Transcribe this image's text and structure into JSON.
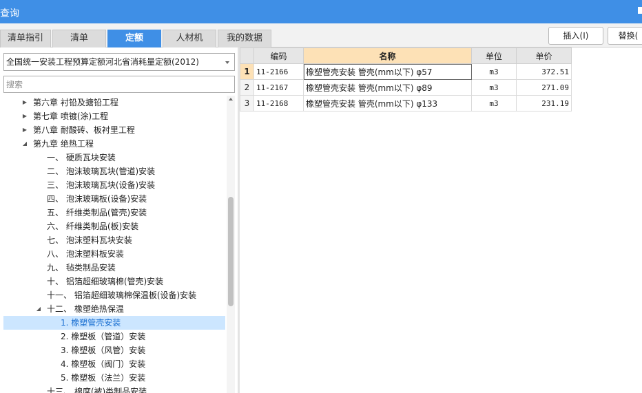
{
  "window": {
    "title": "查询"
  },
  "tabs": [
    {
      "label": "清单指引",
      "active": false
    },
    {
      "label": "清单",
      "active": false
    },
    {
      "label": "定额",
      "active": true
    },
    {
      "label": "人材机",
      "active": false
    },
    {
      "label": "我的数据",
      "active": false
    }
  ],
  "toolbar": {
    "insert_label": "插入(I)",
    "replace_label": "替换("
  },
  "quota_library": {
    "selected": "全国统一安装工程预算定额河北省消耗量定额(2012)"
  },
  "search": {
    "placeholder": "搜索",
    "value": ""
  },
  "tree": [
    {
      "label": "第六章 衬铅及搪铅工程",
      "level": 0,
      "expander": "collapsed"
    },
    {
      "label": "第七章 喷镀(涂)工程",
      "level": 0,
      "expander": "collapsed"
    },
    {
      "label": "第八章 耐酸砖、板衬里工程",
      "level": 0,
      "expander": "collapsed"
    },
    {
      "label": "第九章 绝热工程",
      "level": 0,
      "expander": "expanded"
    },
    {
      "label": "一、 硬质瓦块安装",
      "level": 1,
      "expander": "none"
    },
    {
      "label": "二、 泡沫玻璃瓦块(管道)安装",
      "level": 1,
      "expander": "none"
    },
    {
      "label": "三、 泡沫玻璃瓦块(设备)安装",
      "level": 1,
      "expander": "none"
    },
    {
      "label": "四、 泡沫玻璃板(设备)安装",
      "level": 1,
      "expander": "none"
    },
    {
      "label": "五、 纤维类制品(管壳)安装",
      "level": 1,
      "expander": "none"
    },
    {
      "label": "六、 纤维类制品(板)安装",
      "level": 1,
      "expander": "none"
    },
    {
      "label": "七、 泡沫塑料瓦块安装",
      "level": 1,
      "expander": "none"
    },
    {
      "label": "八、 泡沫塑料板安装",
      "level": 1,
      "expander": "none"
    },
    {
      "label": "九、 毡类制品安装",
      "level": 1,
      "expander": "none"
    },
    {
      "label": "十、 铝箔超细玻璃棉(管壳)安装",
      "level": 1,
      "expander": "none"
    },
    {
      "label": "十一、 铝箔超细玻璃棉保温板(设备)安装",
      "level": 1,
      "expander": "none"
    },
    {
      "label": "十二、 橡塑绝热保温",
      "level": 1,
      "expander": "expanded"
    },
    {
      "label": "1. 橡塑管壳安装",
      "level": 2,
      "expander": "none",
      "selected": true
    },
    {
      "label": "2. 橡塑板（管道）安装",
      "level": 2,
      "expander": "none"
    },
    {
      "label": "3. 橡塑板（风管）安装",
      "level": 2,
      "expander": "none"
    },
    {
      "label": "4. 橡塑板（阀门）安装",
      "level": 2,
      "expander": "none"
    },
    {
      "label": "5. 橡塑板（法兰）安装",
      "level": 2,
      "expander": "none"
    },
    {
      "label": "十三、 棉席(被)类制品安装",
      "level": 1,
      "expander": "none"
    }
  ],
  "grid": {
    "columns": [
      "编码",
      "名称",
      "单位",
      "单价"
    ],
    "highlight_column": 1,
    "rows": [
      {
        "no": "1",
        "code": "11-2166",
        "name": "橡塑管壳安装 管壳(mm以下) φ57",
        "unit": "m3",
        "price": "372.51"
      },
      {
        "no": "2",
        "code": "11-2167",
        "name": "橡塑管壳安装 管壳(mm以下) φ89",
        "unit": "m3",
        "price": "271.09"
      },
      {
        "no": "3",
        "code": "11-2168",
        "name": "橡塑管壳安装 管壳(mm以下) φ133",
        "unit": "m3",
        "price": "231.19"
      }
    ]
  },
  "colors": {
    "accent": "#3f8fe6",
    "header_highlight": "#fde1b6",
    "tree_selection": "#cce6ff"
  }
}
